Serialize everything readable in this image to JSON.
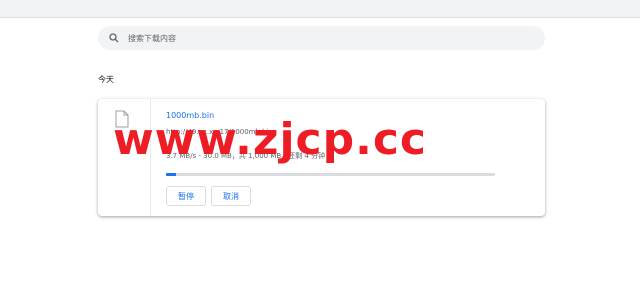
{
  "search": {
    "placeholder": "搜索下载内容"
  },
  "section": {
    "title": "今天"
  },
  "download": {
    "filename": "1000mb.bin",
    "url": "http://49.xx.xx.17/1000mb.bin",
    "status": "3.7 MB/s - 30.0 MB，共 1,000 MB，还剩 4 分钟",
    "progress_fraction": 0.03,
    "pause_label": "暂停",
    "cancel_label": "取消"
  },
  "watermark": {
    "text": "www.zjcp.cc"
  },
  "colors": {
    "accent": "#1a73e8",
    "watermark": "#ee1c25"
  }
}
